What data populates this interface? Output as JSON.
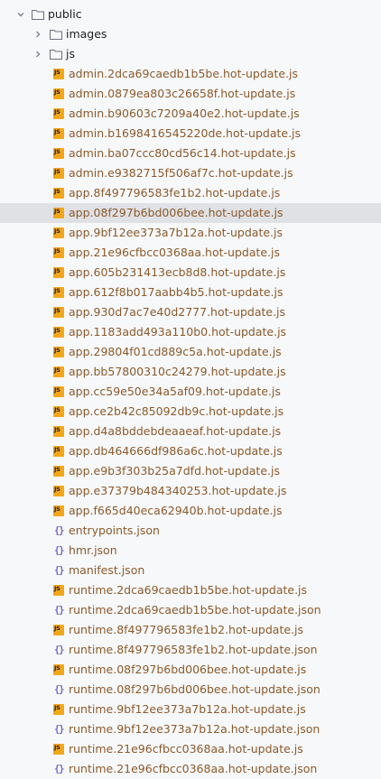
{
  "tree": {
    "root": {
      "label": "public",
      "expanded": true,
      "icon": "folder-icon"
    },
    "folders": [
      {
        "label": "images",
        "expanded": false,
        "icon": "folder-icon"
      },
      {
        "label": "js",
        "expanded": false,
        "icon": "folder-icon"
      }
    ],
    "files": [
      {
        "label": "admin.2dca69caedb1b5be.hot-update.js",
        "type": "js",
        "status": "changed"
      },
      {
        "label": "admin.0879ea803c26658f.hot-update.js",
        "type": "js",
        "status": "changed"
      },
      {
        "label": "admin.b90603c7209a40e2.hot-update.js",
        "type": "js",
        "status": "changed"
      },
      {
        "label": "admin.b1698416545220de.hot-update.js",
        "type": "js",
        "status": "changed"
      },
      {
        "label": "admin.ba07ccc80cd56c14.hot-update.js",
        "type": "js",
        "status": "changed"
      },
      {
        "label": "admin.e9382715f506af7c.hot-update.js",
        "type": "js",
        "status": "changed"
      },
      {
        "label": "app.8f497796583fe1b2.hot-update.js",
        "type": "js",
        "status": "changed"
      },
      {
        "label": "app.08f297b6bd006bee.hot-update.js",
        "type": "js",
        "status": "changed",
        "selected": true
      },
      {
        "label": "app.9bf12ee373a7b12a.hot-update.js",
        "type": "js",
        "status": "changed"
      },
      {
        "label": "app.21e96cfbcc0368aa.hot-update.js",
        "type": "js",
        "status": "changed"
      },
      {
        "label": "app.605b231413ecb8d8.hot-update.js",
        "type": "js",
        "status": "changed"
      },
      {
        "label": "app.612f8b017aabb4b5.hot-update.js",
        "type": "js",
        "status": "changed"
      },
      {
        "label": "app.930d7ac7e40d2777.hot-update.js",
        "type": "js",
        "status": "changed"
      },
      {
        "label": "app.1183add493a110b0.hot-update.js",
        "type": "js",
        "status": "changed"
      },
      {
        "label": "app.29804f01cd889c5a.hot-update.js",
        "type": "js",
        "status": "changed"
      },
      {
        "label": "app.bb57800310c24279.hot-update.js",
        "type": "js",
        "status": "changed"
      },
      {
        "label": "app.cc59e50e34a5af09.hot-update.js",
        "type": "js",
        "status": "changed"
      },
      {
        "label": "app.ce2b42c85092db9c.hot-update.js",
        "type": "js",
        "status": "changed"
      },
      {
        "label": "app.d4a8bddebdeaaeaf.hot-update.js",
        "type": "js",
        "status": "changed"
      },
      {
        "label": "app.db464666df986a6c.hot-update.js",
        "type": "js",
        "status": "changed"
      },
      {
        "label": "app.e9b3f303b25a7dfd.hot-update.js",
        "type": "js",
        "status": "changed"
      },
      {
        "label": "app.e37379b484340253.hot-update.js",
        "type": "js",
        "status": "changed"
      },
      {
        "label": "app.f665d40eca62940b.hot-update.js",
        "type": "js",
        "status": "changed"
      },
      {
        "label": "entrypoints.json",
        "type": "json",
        "status": "changed"
      },
      {
        "label": "hmr.json",
        "type": "json",
        "status": "changed"
      },
      {
        "label": "manifest.json",
        "type": "json",
        "status": "changed"
      },
      {
        "label": "runtime.2dca69caedb1b5be.hot-update.js",
        "type": "js",
        "status": "changed"
      },
      {
        "label": "runtime.2dca69caedb1b5be.hot-update.json",
        "type": "json",
        "status": "changed"
      },
      {
        "label": "runtime.8f497796583fe1b2.hot-update.js",
        "type": "js",
        "status": "changed"
      },
      {
        "label": "runtime.8f497796583fe1b2.hot-update.json",
        "type": "json",
        "status": "changed"
      },
      {
        "label": "runtime.08f297b6bd006bee.hot-update.js",
        "type": "js",
        "status": "changed"
      },
      {
        "label": "runtime.08f297b6bd006bee.hot-update.json",
        "type": "json",
        "status": "changed"
      },
      {
        "label": "runtime.9bf12ee373a7b12a.hot-update.js",
        "type": "js",
        "status": "changed"
      },
      {
        "label": "runtime.9bf12ee373a7b12a.hot-update.json",
        "type": "json",
        "status": "changed"
      },
      {
        "label": "runtime.21e96cfbcc0368aa.hot-update.js",
        "type": "js",
        "status": "changed"
      },
      {
        "label": "runtime.21e96cfbcc0368aa.hot-update.json",
        "type": "json",
        "status": "changed"
      }
    ]
  },
  "colors": {
    "background": "#f7f8fa",
    "selected_row": "#dfe1e5",
    "changed_text": "#8b5a2b",
    "default_text": "#1f1f1f",
    "js_badge": "#f2a71b",
    "json_badge": "#7b68c9",
    "folder_stroke": "#6c707e"
  }
}
